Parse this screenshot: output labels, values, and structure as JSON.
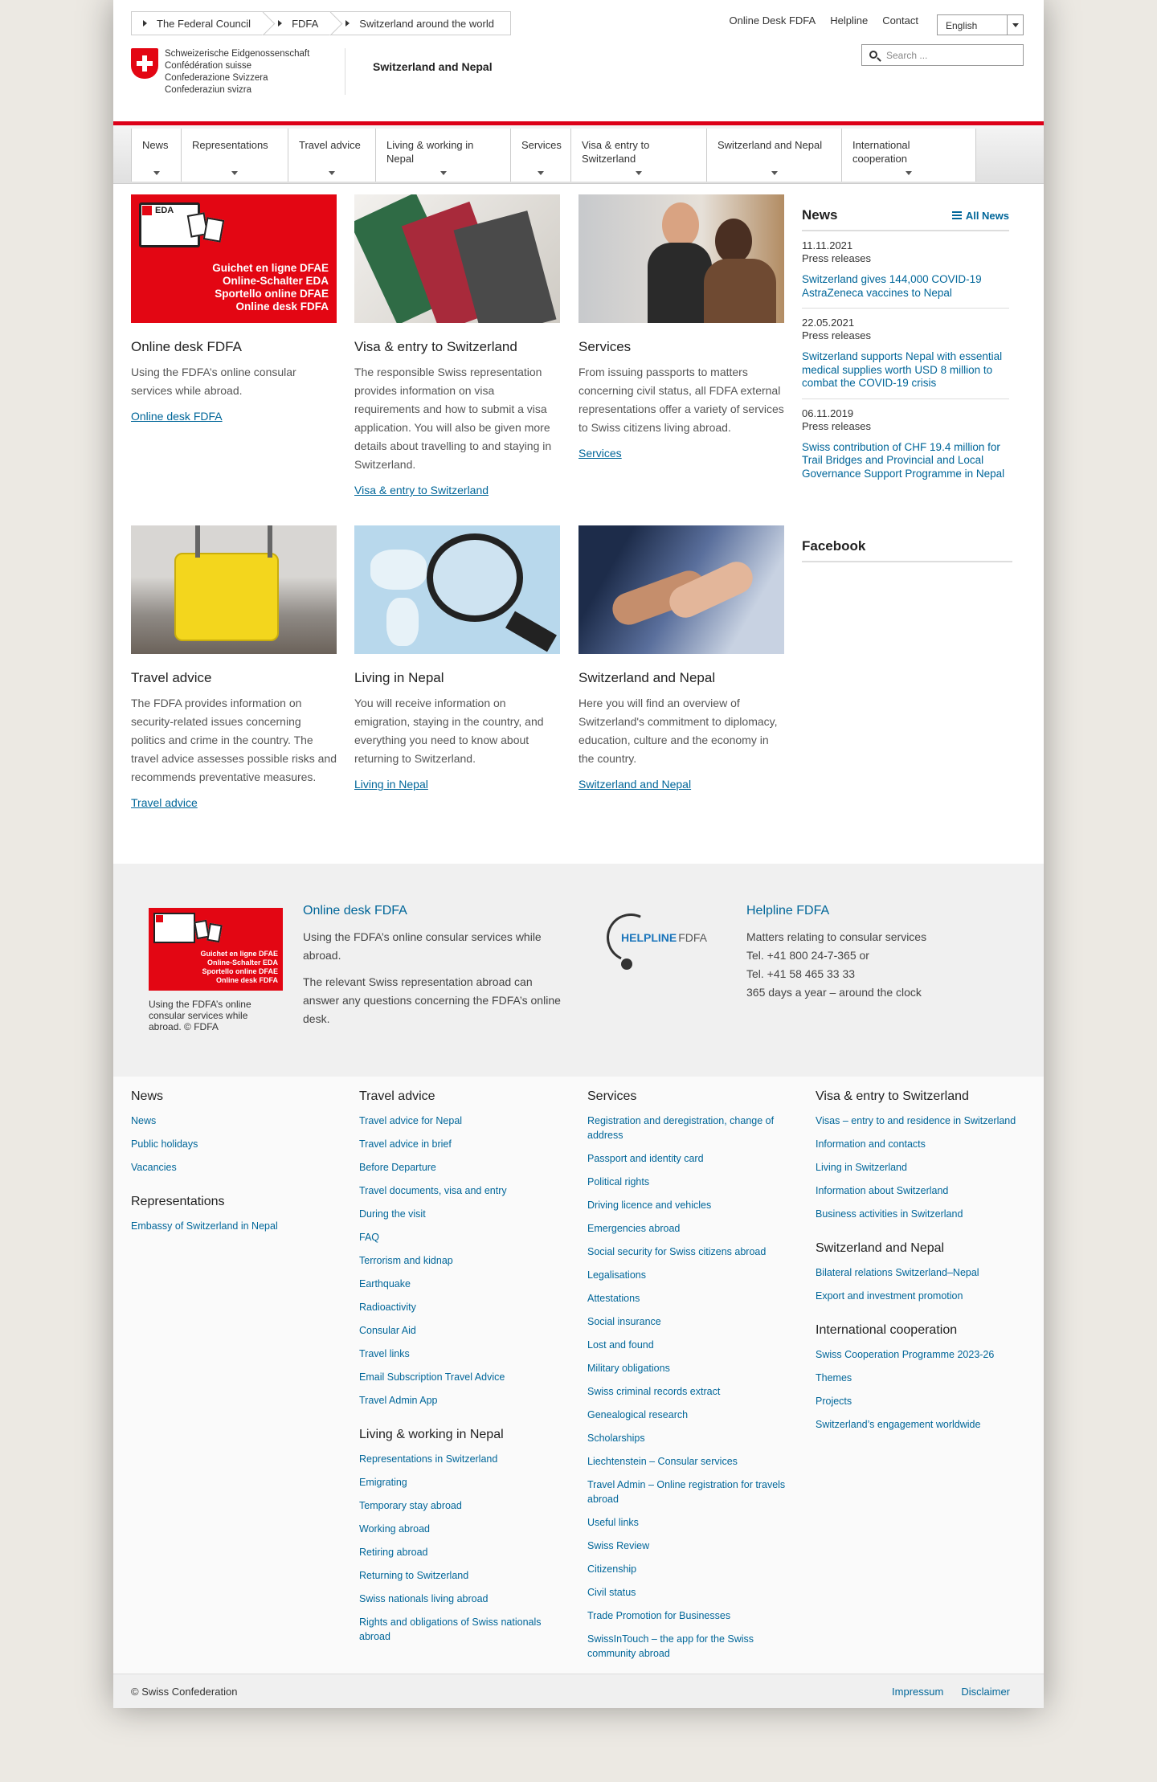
{
  "breadcrumb": [
    "The Federal Council",
    "FDFA",
    "Switzerland around the world"
  ],
  "toplinks": [
    "Online Desk FDFA",
    "Helpline",
    "Contact"
  ],
  "language": "English",
  "search_placeholder": "Search ...",
  "logo_lines": [
    "Schweizerische Eidgenossenschaft",
    "Confédération suisse",
    "Confederazione Svizzera",
    "Confederaziun svizra"
  ],
  "site_title": "Switzerland and Nepal",
  "nav": [
    "News",
    "Representations",
    "Travel advice",
    "Living & working in Nepal",
    "Services",
    "Visa & entry to Switzerland",
    "Switzerland and Nepal",
    "International cooperation"
  ],
  "cards": [
    {
      "title": "Online desk FDFA",
      "text": "Using the FDFA’s online consular services while abroad.",
      "link": "Online desk FDFA",
      "img_lines": [
        "Guichet en ligne DFAE",
        "Online-Schalter EDA",
        "Sportello online DFAE",
        "Online desk FDFA"
      ],
      "img_label": "EDA"
    },
    {
      "title": "Visa & entry to Switzerland",
      "text": "The responsible Swiss representation provides information on visa requirements and how to submit a visa application. You will also be given more details about travelling to and staying in Switzerland.",
      "link": "Visa & entry to Switzerland"
    },
    {
      "title": "Services",
      "text": "From issuing passports to matters concerning civil status, all FDFA external representations offer a variety of services to Swiss citizens living abroad.",
      "link": "Services"
    },
    {
      "title": "Travel advice",
      "text": "The FDFA provides information on security-related issues concerning politics and crime in the country. The travel advice assesses possible risks and recommends preventative measures.",
      "link": "Travel advice"
    },
    {
      "title": "Living in Nepal",
      "text": "You will receive information on emigration, staying in the country, and everything you need to know about returning to Switzerland.",
      "link": "Living in Nepal"
    },
    {
      "title": "Switzerland and Nepal",
      "text": "Here you will find an overview of Switzerland's commitment to diplomacy, education, culture and the economy in the country.",
      "link": "Switzerland and Nepal"
    }
  ],
  "news": {
    "heading": "News",
    "all": "All News",
    "items": [
      {
        "date": "11.11.2021",
        "type": "Press releases",
        "title": "Switzerland gives 144,000 COVID-19 AstraZeneca vaccines to Nepal"
      },
      {
        "date": "22.05.2021",
        "type": "Press releases",
        "title": "Switzerland supports Nepal with essential medical supplies worth USD 8 million to combat the COVID-19 crisis"
      },
      {
        "date": "06.11.2019",
        "type": "Press releases",
        "title": "Swiss contribution of CHF 19.4 million for Trail Bridges and Provincial and Local Governance Support Programme in Nepal"
      }
    ]
  },
  "facebook": "Facebook",
  "band": {
    "caption": "Using the FDFA’s online consular services while abroad. © FDFA",
    "online": {
      "title": "Online desk FDFA",
      "p1": "Using the FDFA’s online consular services while abroad.",
      "p2": "The relevant Swiss representation abroad can answer any questions concerning the FDFA’s online desk."
    },
    "helpline_logo": [
      "HELPLINE",
      "FDFA"
    ],
    "helpline": {
      "title": "Helpline FDFA",
      "lines": [
        "Matters relating to consular services",
        "Tel. +41 800 24-7-365 or",
        "Tel. +41 58 465 33 33",
        "365 days a year – around the clock"
      ]
    }
  },
  "footer_cols": [
    [
      {
        "heading": "News",
        "links": [
          "News",
          "Public holidays",
          "Vacancies"
        ]
      },
      {
        "heading": "Representations",
        "links": [
          "Embassy of Switzerland in Nepal"
        ]
      }
    ],
    [
      {
        "heading": "Travel advice",
        "links": [
          "Travel advice for Nepal",
          "Travel advice in brief",
          "Before Departure",
          "Travel documents, visa and entry",
          "During the visit",
          "FAQ",
          "Terrorism and kidnap",
          "Earthquake",
          "Radioactivity",
          "Consular Aid",
          "Travel links",
          "Email Subscription Travel Advice",
          "Travel Admin App"
        ]
      },
      {
        "heading": "Living & working in Nepal",
        "links": [
          "Representations in Switzerland",
          "Emigrating",
          "Temporary stay abroad",
          "Working abroad",
          "Retiring abroad",
          "Returning to Switzerland",
          "Swiss nationals living abroad",
          "Rights and obligations of Swiss nationals abroad"
        ]
      }
    ],
    [
      {
        "heading": "Services",
        "links": [
          "Registration and deregistration, change of address",
          "Passport and identity card",
          "Political rights",
          "Driving licence and vehicles",
          "Emergencies abroad",
          "Social security for Swiss citizens abroad",
          "Legalisations",
          "Attestations",
          "Social insurance",
          "Lost and found",
          "Military obligations",
          "Swiss criminal records extract",
          "Genealogical research",
          "Scholarships",
          "Liechtenstein – Consular services",
          "Travel Admin – Online registration for travels abroad",
          "Useful links",
          "Swiss Review",
          "Citizenship",
          "Civil status",
          "Trade Promotion for Businesses",
          "SwissInTouch – the app for the Swiss community abroad"
        ]
      }
    ],
    [
      {
        "heading": "Visa & entry to Switzerland",
        "links": [
          "Visas – entry to and residence in Switzerland",
          "Information and contacts",
          "Living in Switzerland",
          "Information about Switzerland",
          "Business activities in Switzerland"
        ]
      },
      {
        "heading": "Switzerland and Nepal",
        "links": [
          "Bilateral relations Switzerland–Nepal",
          "Export and investment promotion"
        ]
      },
      {
        "heading": "International cooperation",
        "links": [
          "Swiss Cooperation Programme 2023-26",
          "Themes",
          "Projects",
          "Switzerland’s engagement worldwide"
        ]
      }
    ]
  ],
  "footer": {
    "copyright": "© Swiss Confederation",
    "links": [
      "Impressum",
      "Disclaimer"
    ]
  }
}
